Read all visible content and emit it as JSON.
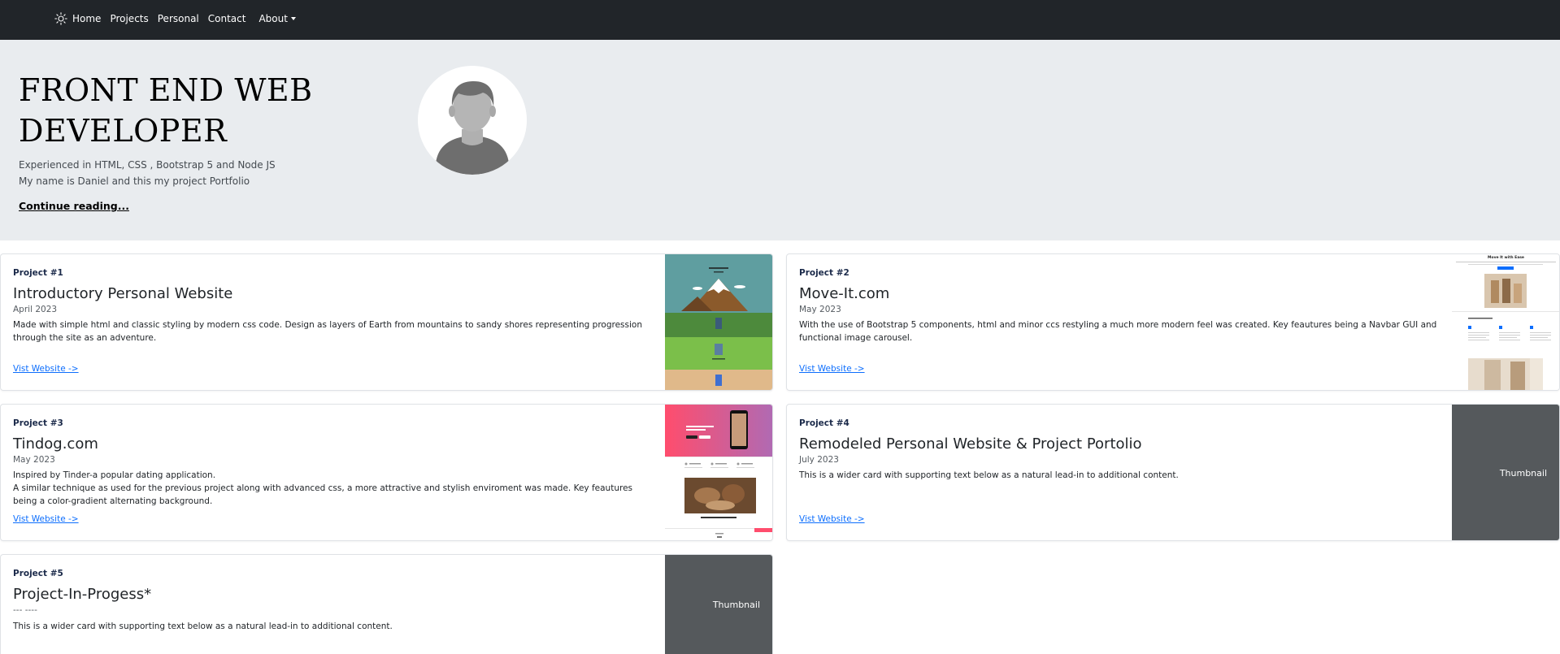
{
  "nav": {
    "icon": "sun-icon",
    "items": [
      "Home",
      "Projects",
      "Personal",
      "Contact"
    ],
    "about": "About"
  },
  "hero": {
    "title_line1": "FRONT END WEB",
    "title_line2": "DEVELOPER",
    "line1": "Experienced in HTML, CSS , Bootstrap 5 and Node JS",
    "line2": "My name is Daniel and this my project Portfolio",
    "link": "Continue reading...",
    "avatar": "person-avatar-icon"
  },
  "projects": [
    {
      "kicker": "Project #1",
      "title": "Introductory Personal Website",
      "date": "April 2023",
      "text": [
        "Made with simple html and classic styling by modern css code. Design as layers of Earth from mountains to sandy shores representing progression through the site as an adventure."
      ],
      "link": "Vist Website ->"
    },
    {
      "kicker": "Project #2",
      "title": "Move-It.com",
      "date": "May 2023",
      "text": [
        "With the use of Bootstrap 5 components, html and minor ccs restyling a much more modern feel was created. Key feautures being a Navbar GUI and functional image carousel."
      ],
      "link": "Vist Website ->",
      "thumb_heading": "Move It with Ease"
    },
    {
      "kicker": "Project #3",
      "title": "Tindog.com",
      "date": "May 2023",
      "text": [
        "Inspired by Tinder-a popular dating application.",
        "A similar technique as used for the previous project along with advanced css, a more attractive and stylish enviroment was made. Key feautures being a color-gradient alternating background."
      ],
      "link": "Vist Website ->"
    },
    {
      "kicker": "Project #4",
      "title": "Remodeled Personal Website & Project Portolio",
      "date": "July 2023",
      "text": [
        "This is a wider card with supporting text below as a natural lead-in to additional content."
      ],
      "link": "Vist Website ->",
      "thumb_label": "Thumbnail"
    },
    {
      "kicker": "Project #5",
      "title": "Project-In-Progess*",
      "date": "--- ----",
      "text": [
        "This is a wider card with supporting text below as a natural lead-in to additional content."
      ],
      "thumb_label": "Thumbnail"
    }
  ],
  "colors": {
    "navbar": "#212529",
    "hero_bg": "#e9ecef",
    "link": "#0d6efd",
    "thumbnail": "#55595c"
  }
}
